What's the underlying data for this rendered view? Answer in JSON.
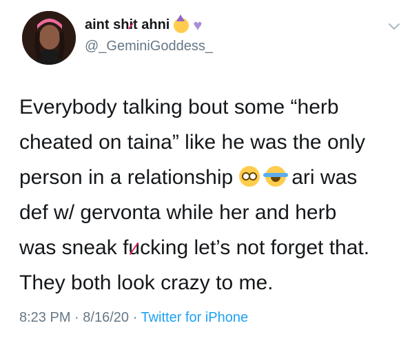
{
  "author": {
    "name_part1": "aint sh",
    "name_censored_char": "i",
    "name_part2": "t ahni",
    "name_emojis": [
      "partying-face-icon",
      "purple-heart-icon"
    ],
    "handle": "@_GeminiGoddess_"
  },
  "tweet": {
    "line1": "Everybody talking bout some “herb",
    "line2": "cheated on taina” like he was the only",
    "line3_before": "person in a relationship",
    "line3_emojis": [
      "flushed-face-icon",
      "tears-of-joy-icon"
    ],
    "line3_after": "ari was",
    "line4": "def w/ gervonta while her and herb",
    "line5_before": "was sneak f",
    "line5_censored_char": "u",
    "line5_after": "cking let’s not forget that.",
    "line6": "They both look crazy to me."
  },
  "meta": {
    "time": "8:23 PM",
    "separator": "·",
    "date": "8/16/20",
    "source": "Twitter for iPhone"
  },
  "colors": {
    "text": "#14171a",
    "secondary": "#657786",
    "link": "#1da1f2",
    "censor_strike": "#e0245e"
  }
}
